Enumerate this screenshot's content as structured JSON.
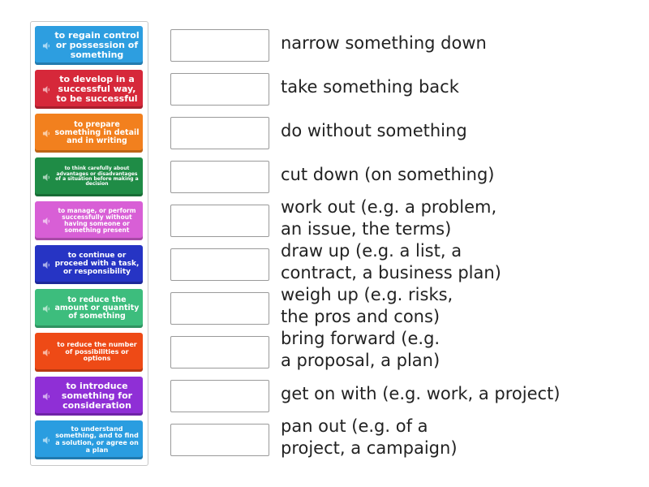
{
  "cards": [
    {
      "text": "to regain control or possession of something",
      "color": "#2d9ee0"
    },
    {
      "text": "to develop in a successful way, to be successful",
      "color": "#d6283a"
    },
    {
      "text": "to prepare something in detail and in writing",
      "color": "#f2801e"
    },
    {
      "text": "to think carefully about advantages or disadvantages of a situation before making a decision",
      "color": "#1f8c46"
    },
    {
      "text": "to manage, or perform successfully without having someone or something present",
      "color": "#d85fd6"
    },
    {
      "text": "to continue or proceed with a task, or responsibility",
      "color": "#2634c4"
    },
    {
      "text": "to reduce the amount or quantity of something",
      "color": "#3dbd7d"
    },
    {
      "text": "to reduce the number of possibilities or options",
      "color": "#ee4a16"
    },
    {
      "text": "to introduce something for consideration",
      "color": "#8f2fd6"
    },
    {
      "text": "to understand something, and to find a solution, or agree on a plan",
      "color": "#2a9de0"
    }
  ],
  "terms": [
    "narrow something down",
    "take something back",
    "do without something",
    "cut down (on something)",
    "work out (e.g. a problem,\nan issue, the terms)",
    "draw up (e.g. a list, a\ncontract, a business plan)",
    "weigh up (e.g. risks,\nthe pros and cons)",
    "bring forward (e.g.\na proposal, a plan)",
    "get on with (e.g. work, a project)",
    "pan out (e.g. of a\nproject, a campaign)"
  ]
}
